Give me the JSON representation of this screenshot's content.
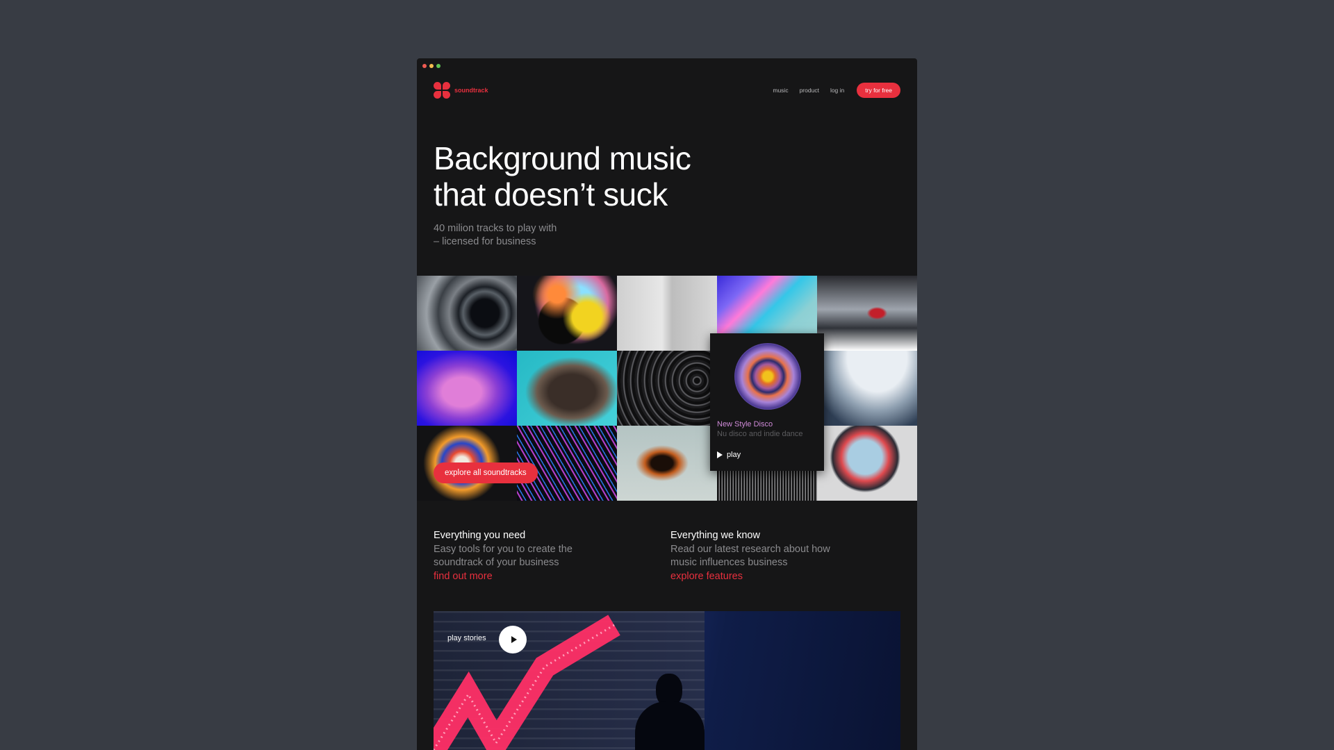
{
  "brand": {
    "name": "soundtrack",
    "accent": "#e8303e"
  },
  "nav": {
    "links": [
      "music",
      "product",
      "log in"
    ],
    "cta": "try for free"
  },
  "hero": {
    "title_lines": [
      "Background music",
      "that doesn’t suck"
    ],
    "subtitle_lines": [
      "40 milion tracks to play with",
      "– licensed for business"
    ]
  },
  "featured": {
    "title": "New Style Disco",
    "description": "Nu disco and indie dance",
    "play_label": "play"
  },
  "explore_button": "explore all soundtracks",
  "features": [
    {
      "title": "Everything you need",
      "text_lines": [
        "Easy tools for you to create the",
        "soundtrack of your business"
      ],
      "link": "find out more"
    },
    {
      "title": "Everything we know",
      "text_lines": [
        "Read our latest research about how",
        "music influences business"
      ],
      "link": "explore features"
    }
  ],
  "stories": {
    "label": "play stories"
  },
  "icons": {
    "logo": "soundtrack-logo-icon",
    "play": "play-icon"
  }
}
